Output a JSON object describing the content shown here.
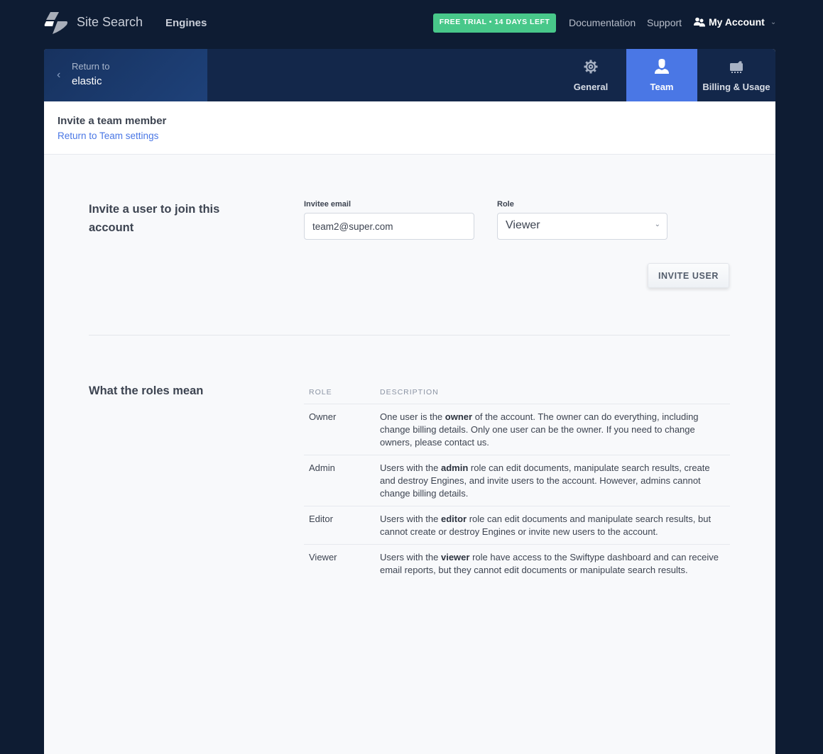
{
  "topnav": {
    "brand": "Site Search",
    "engines_link": "Engines",
    "trial_badge": "FREE TRIAL • 14 DAYS LEFT",
    "documentation_link": "Documentation",
    "support_link": "Support",
    "account_label": "My Account",
    "colors": {
      "background": "#0e1c33",
      "trial": "#48c88a"
    }
  },
  "settings_header": {
    "back_label": "Return to",
    "back_name": "elastic",
    "tabs": [
      {
        "label": "General",
        "icon": "gear-icon",
        "active": false
      },
      {
        "label": "Team",
        "icon": "user-icon",
        "active": true
      },
      {
        "label": "Billing & Usage",
        "icon": "billing-icon",
        "active": false
      }
    ],
    "accent": "#4a77e5"
  },
  "subheader": {
    "title": "Invite a team member",
    "back_link": "Return to Team settings"
  },
  "invite_section": {
    "title": "Invite a user to join this account",
    "email_label": "Invitee email",
    "email_value": "team2@super.com",
    "role_label": "Role",
    "role_value": "Viewer",
    "submit_label": "INVITE USER"
  },
  "roles_section": {
    "title": "What the roles mean",
    "columns": [
      "ROLE",
      "DESCRIPTION"
    ],
    "rows": [
      {
        "role": "Owner",
        "pre": "One user is the ",
        "bold": "owner",
        "post": " of the account. The owner can do everything, including change billing details. Only one user can be the owner. If you need to change owners, please contact us."
      },
      {
        "role": "Admin",
        "pre": "Users with the ",
        "bold": "admin",
        "post": " role can edit documents, manipulate search results, create and destroy Engines, and invite users to the account. However, admins cannot change billing details."
      },
      {
        "role": "Editor",
        "pre": "Users with the ",
        "bold": "editor",
        "post": " role can edit documents and manipulate search results, but cannot create or destroy Engines or invite new users to the account."
      },
      {
        "role": "Viewer",
        "pre": "Users with the ",
        "bold": "viewer",
        "post": " role have access to the Swiftype dashboard and can receive email reports, but they cannot edit documents or manipulate search results."
      }
    ]
  }
}
